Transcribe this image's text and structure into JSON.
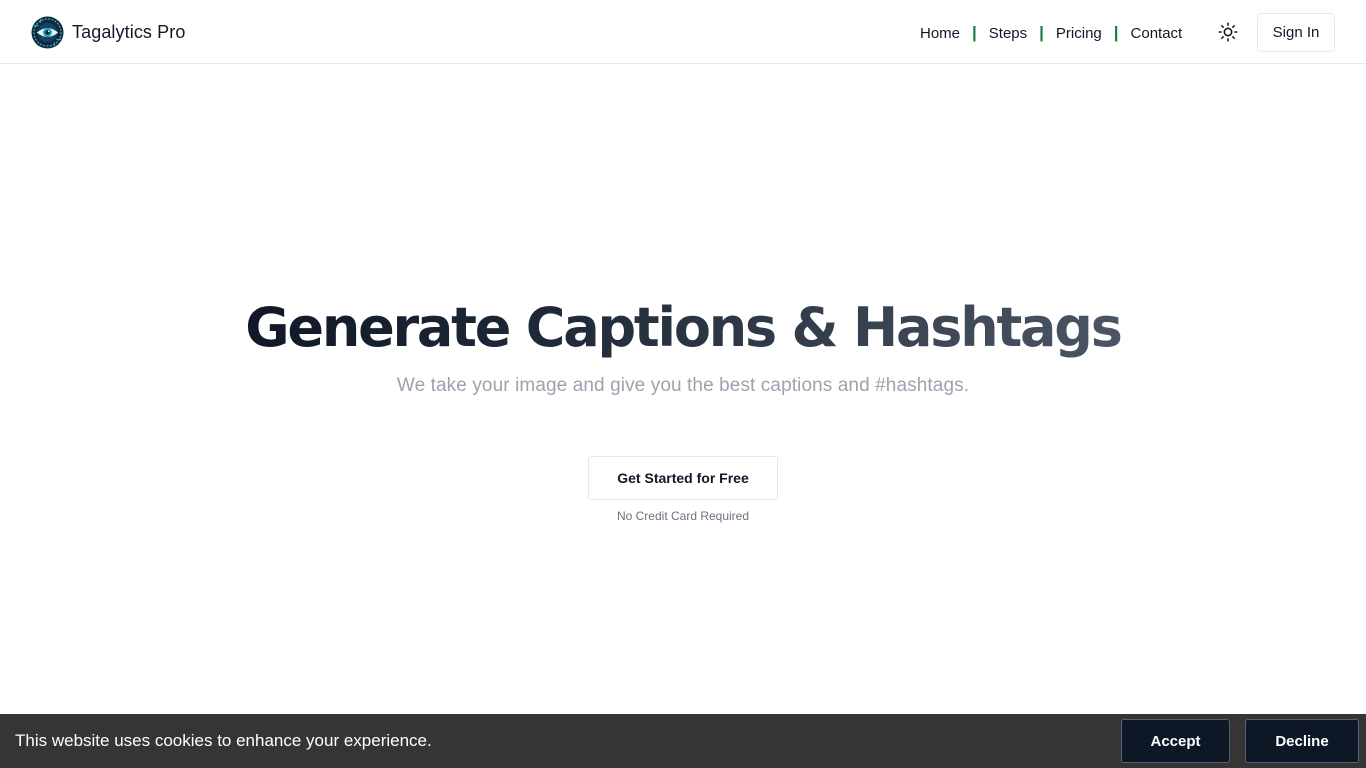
{
  "brand": {
    "name": "Tagalytics Pro",
    "logo_icon": "circuit-eye-logo"
  },
  "nav": {
    "items": [
      {
        "label": "Home"
      },
      {
        "label": "Steps"
      },
      {
        "label": "Pricing"
      },
      {
        "label": "Contact"
      }
    ],
    "separator": "|",
    "separator_color": "#15803d",
    "theme_toggle_icon": "sun-icon",
    "signin_label": "Sign In"
  },
  "hero": {
    "title": "Generate Captions & Hashtags",
    "subtitle": "We take your image and give you the best captions and #hashtags.",
    "cta_label": "Get Started for Free",
    "cta_note": "No Credit Card Required"
  },
  "cookie": {
    "message": "This website uses cookies to enhance your experience.",
    "accept_label": "Accept",
    "decline_label": "Decline"
  },
  "colors": {
    "cookie_bar_bg": "#353535",
    "cookie_button_bg": "#0d1726",
    "subtitle_text": "#9ca3af"
  }
}
